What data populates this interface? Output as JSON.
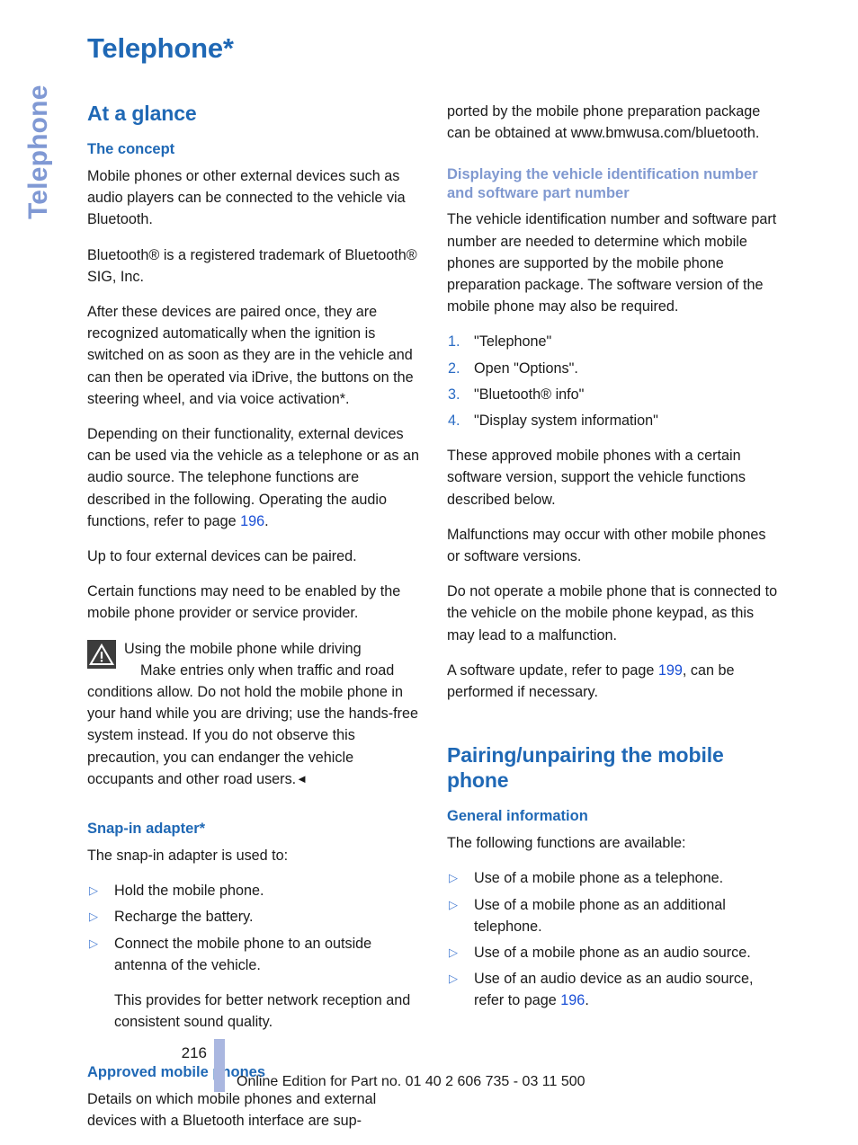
{
  "side_tab": {
    "label": "Telephone"
  },
  "page_title": "Telephone*",
  "left_column": {
    "section_heading": "At a glance",
    "concept": {
      "heading": "The concept",
      "p1": "Mobile phones or other external devices such as audio players can be connected to the vehicle via Bluetooth.",
      "p2": "Bluetooth® is a registered trademark of Bluetooth® SIG, Inc.",
      "p3": "After these devices are paired once, they are recognized automatically when the ignition is switched on as soon as they are in the vehicle and can then be operated via iDrive, the buttons on the steering wheel, and via voice activation*.",
      "p4_a": "Depending on their functionality, external devices can be used via the vehicle as a telephone or as an audio source. The telephone functions are described in the following. Operating the audio functions, refer to page ",
      "p4_page": "196",
      "p4_b": ".",
      "p5": "Up to four external devices can be paired.",
      "p6": "Certain functions may need to be enabled by the mobile phone provider or service provider."
    },
    "warning": {
      "icon": "warning-triangle-icon",
      "title": "Using the mobile phone while driving",
      "body": "Make entries only when traffic and road conditions allow. Do not hold the mobile phone in your hand while you are driving; use the hands-free system instead. If you do not observe this precaution, you can endanger the vehicle occupants and other road users.",
      "end_marker": "◄"
    },
    "snap_in": {
      "heading": "Snap-in adapter*",
      "intro": "The snap-in adapter is used to:",
      "bullet_marker": "▷",
      "bullets": [
        "Hold the mobile phone.",
        "Recharge the battery.",
        "Connect the mobile phone to an outside antenna of the vehicle."
      ],
      "sub_note": "This provides for better network reception and consistent sound quality."
    },
    "approved": {
      "heading": "Approved mobile phones",
      "p1": "Details on which mobile phones and external devices with a Bluetooth interface are sup-"
    }
  },
  "right_column": {
    "continuation": "ported by the mobile phone preparation package can be obtained at www.bmwusa.com/bluetooth.",
    "vin": {
      "heading": "Displaying the vehicle identification number and software part number",
      "p1": "The vehicle identification number and software part number are needed to determine which mobile phones are supported by the mobile phone preparation package. The software version of the mobile phone may also be required.",
      "steps": [
        {
          "marker": "1.",
          "text": "\"Telephone\""
        },
        {
          "marker": "2.",
          "text": "Open \"Options\"."
        },
        {
          "marker": "3.",
          "text": "\"Bluetooth® info\""
        },
        {
          "marker": "4.",
          "text": "\"Display system information\""
        }
      ],
      "p2": "These approved mobile phones with a certain software version, support the vehicle functions described below.",
      "p3": "Malfunctions may occur with other mobile phones or software versions.",
      "p4": "Do not operate a mobile phone that is connected to the vehicle on the mobile phone keypad, as this may lead to a malfunction.",
      "p5_a": "A software update, refer to page ",
      "p5_page": "199",
      "p5_b": ", can be performed if necessary."
    },
    "pairing": {
      "section_heading": "Pairing/unpairing the mobile phone",
      "general_heading": "General information",
      "intro": "The following functions are available:",
      "bullet_marker": "▷",
      "bullets": [
        {
          "text": "Use of a mobile phone as a telephone.",
          "page": ""
        },
        {
          "text": "Use of a mobile phone as an additional telephone.",
          "page": ""
        },
        {
          "text": "Use of a mobile phone as an audio source.",
          "page": ""
        },
        {
          "text_a": "Use of an audio device as an audio source, refer to page ",
          "page": "196",
          "text_b": "."
        }
      ]
    }
  },
  "footer": {
    "page_number": "216",
    "text": "Online Edition for Part no. 01 40 2 606 735 - 03 11 500"
  },
  "colors": {
    "heading_blue": "#1f68b5",
    "light_blue": "#8099d0",
    "side_tab_blue": "#8099d4",
    "link_blue": "#1a4fd6",
    "bullet_blue": "#4a7fd4",
    "footer_rule": "#aab7e0",
    "warning_icon_bg": "#3c3c3c",
    "text": "#1a1a1a"
  }
}
